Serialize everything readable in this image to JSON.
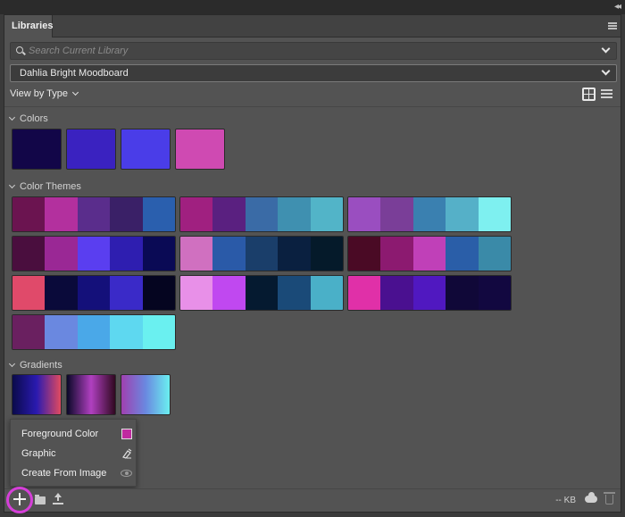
{
  "panel": {
    "tab_label": "Libraries",
    "search_placeholder": "Search Current Library",
    "library_name": "Dahlia Bright Moodboard",
    "view_by_label": "View by Type"
  },
  "sections": {
    "colors": {
      "label": "Colors",
      "items": [
        "#120648",
        "#3a22c0",
        "#4a3de8",
        "#cf4ab2"
      ]
    },
    "color_themes": {
      "label": "Color Themes",
      "rows": [
        [
          [
            "#6b1450",
            "#b3309e",
            "#5a2d8c",
            "#3a2067",
            "#2a5fae"
          ],
          [
            "#a02080",
            "#5a2080",
            "#3a6ba6",
            "#3f90b0",
            "#52b4c8"
          ],
          [
            "#9a4ec0",
            "#7a3e98",
            "#3a80b0",
            "#55b0c8",
            "#7ef0f0"
          ]
        ],
        [
          [
            "#4a0e3e",
            "#9a2895",
            "#5a3ef0",
            "#2e1eb0",
            "#0a0a55"
          ],
          [
            "#d070c0",
            "#2a5aa8",
            "#1a3e6a",
            "#0a2040",
            "#051a2a"
          ],
          [
            "#4a0a25",
            "#8c1a70",
            "#c040b8",
            "#2a5ea8",
            "#3a8aa8"
          ]
        ],
        [
          [
            "#e04a6a",
            "#0a0a3a",
            "#14107a",
            "#3a2ac8",
            "#050520"
          ],
          [
            "#e890e8",
            "#c048f0",
            "#051a30",
            "#1a4a78",
            "#4ab0c8"
          ],
          [
            "#e030a8",
            "#4a1090",
            "#5018c0",
            "#100838",
            "#120840"
          ]
        ],
        [
          [
            "#6a2060",
            "#6a88e0",
            "#4aa8e8",
            "#5ed8f0",
            "#6af0f0"
          ]
        ]
      ]
    },
    "gradients": {
      "label": "Gradients",
      "items": [
        [
          "#0a0a4a",
          "#2a1ab0",
          "#e04a60"
        ],
        [
          "#0a0828",
          "#b040c0",
          "#300820"
        ],
        [
          "#a040b0",
          "#6a88e0",
          "#6af0f0"
        ]
      ]
    }
  },
  "popup_menu": {
    "items": [
      {
        "label": "Foreground Color",
        "swatch": "#c02aa0"
      },
      {
        "label": "Graphic"
      },
      {
        "label": "Create From Image"
      }
    ]
  },
  "footer": {
    "size_label": "-- KB"
  },
  "colors": {
    "panel_bg": "#535353",
    "highlight_ring": "#d63fd9"
  }
}
